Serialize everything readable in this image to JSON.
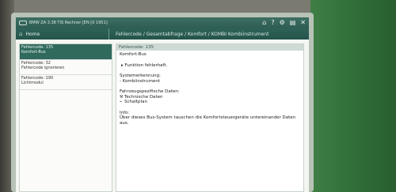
{
  "window": {
    "title": "BMW ZA 3.38 TIS Rechner   [EN [0 1951]",
    "icons": [
      "home-icon",
      "help-icon",
      "settings-icon",
      "print-icon",
      "close-icon"
    ],
    "icon_glyphs": [
      "⌂",
      "?",
      "⚙",
      "▤",
      "✕"
    ]
  },
  "nav": {
    "home_label": "Home",
    "breadcrumb": "Fehlercode / Gesamtabfrage / Komfort / KOMBI Kombiinstrument"
  },
  "fault_list": [
    {
      "code": "Fehlercode: 135",
      "name": "Komfort-Bus",
      "selected": true
    },
    {
      "code": "Fehlercode: 32",
      "name": "Fehlercode ignorieren",
      "selected": false
    },
    {
      "code": "Fehlercode: 190",
      "name": "Lichtmodul",
      "selected": false
    }
  ],
  "detail": {
    "header": "Fehlercode: 135",
    "title": "Komfort-Bus",
    "function_line": "▸ Funktion fehlerhaft.",
    "system_label": "Systemerkennung:",
    "system_value": "- Kombiinstrument",
    "vehicle_label": "Fahrzeugspezifische Daten:",
    "tech_data": "Technische Daten",
    "schematic": "Schaltplan",
    "info_label": "Info:",
    "info_text": "Über dieses Bus-System tauschen die Komfortsteuergeräte untereinander Daten aus."
  }
}
